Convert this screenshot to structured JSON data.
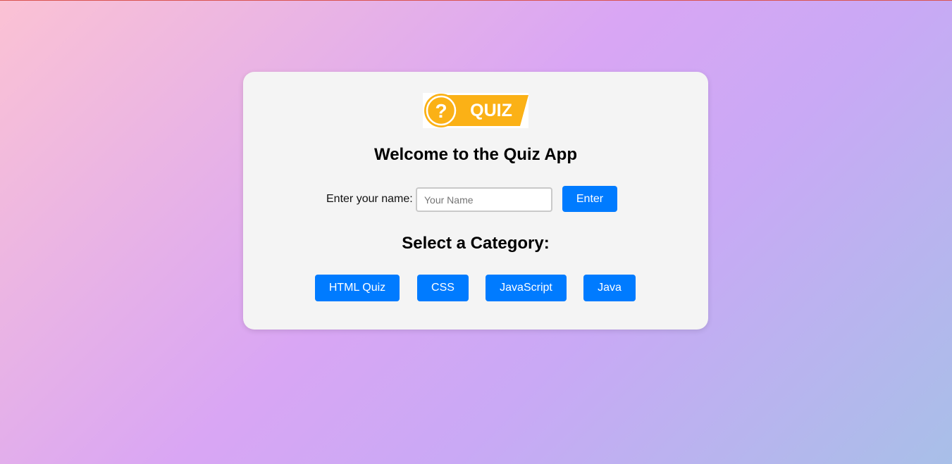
{
  "logo": {
    "icon": "question-mark-icon",
    "symbol": "?",
    "text": "QUIZ",
    "color": "#fbb116"
  },
  "title": "Welcome to the Quiz App",
  "name_form": {
    "label": "Enter your name:",
    "placeholder": "Your Name",
    "value": "",
    "button_label": "Enter"
  },
  "category_heading": "Select a Category:",
  "categories": [
    {
      "label": "HTML Quiz"
    },
    {
      "label": "CSS"
    },
    {
      "label": "JavaScript"
    },
    {
      "label": "Java"
    }
  ],
  "colors": {
    "accent": "#007bff",
    "card": "#f4f4f4",
    "logo": "#fbb116"
  }
}
